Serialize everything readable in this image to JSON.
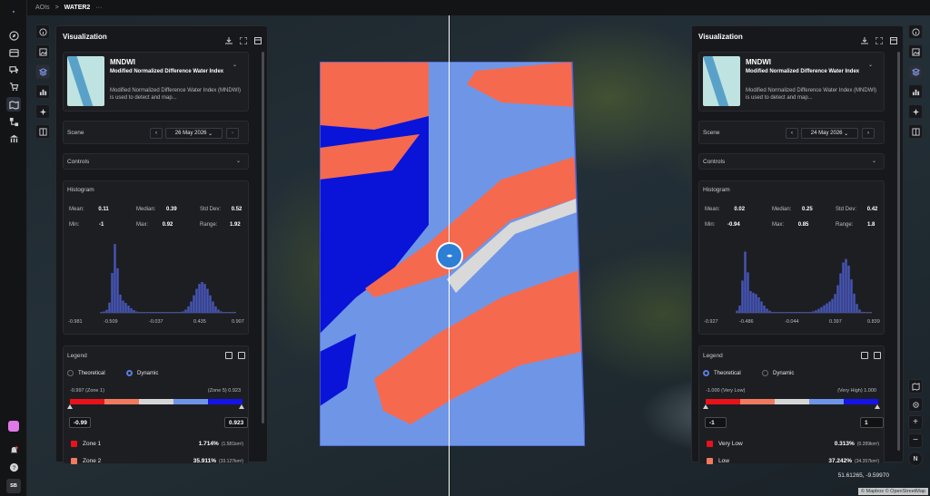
{
  "breadcrumb": {
    "root": "AOIs",
    "sep": ">",
    "current": "WATER2",
    "more": "···"
  },
  "nav": [
    "explore-icon",
    "orders-icon",
    "truck-icon",
    "cart-icon",
    "chart-icon",
    "map-icon",
    "network-icon",
    "wand-icon",
    "library-icon"
  ],
  "user_initials": "SB",
  "panels": {
    "left": {
      "title": "Visualization",
      "index": {
        "name": "MNDWI",
        "full": "Modified Normalized Difference Water Index",
        "desc": "Modified Normalized Difference Water Index (MNDWI) is used to detect and map..."
      },
      "scene_label": "Scene",
      "date": "26 May 2026",
      "controls_label": "Controls",
      "histogram_label": "Histogram",
      "stats": {
        "mean_label": "Mean:",
        "mean": "0.11",
        "median_label": "Median:",
        "median": "0.39",
        "std_label": "Std Dev:",
        "std": "0.52",
        "min_label": "Min:",
        "min": "-1",
        "max_label": "Max:",
        "max": "0.92",
        "range_label": "Range:",
        "range": "1.92"
      },
      "hist_ticks": [
        "-0.981",
        "-0.509",
        "-0.037",
        "0.435",
        "0.907"
      ],
      "legend_label": "Legend",
      "mode_a": "Theoretical",
      "mode_b": "Dynamic",
      "active_mode": "Dynamic",
      "lg_left": "-0.997 (Zone 1)",
      "lg_right": "(Zone 5) 0.923",
      "min_value": "-0.99",
      "max_value": "0.923",
      "zones": [
        {
          "name": "Zone 1",
          "pct": "1.714%",
          "area": "(1.581km²)",
          "color": "#e8121a"
        },
        {
          "name": "Zone 2",
          "pct": "35.911%",
          "area": "(33.127km²)",
          "color": "#f07a5d"
        }
      ]
    },
    "right": {
      "title": "Visualization",
      "index": {
        "name": "MNDWI",
        "full": "Modified Normalized Difference Water Index",
        "desc": "Modified Normalized Difference Water Index (MNDWI) is used to detect and map..."
      },
      "scene_label": "Scene",
      "date": "24 May 2026",
      "controls_label": "Controls",
      "histogram_label": "Histogram",
      "stats": {
        "mean_label": "Mean:",
        "mean": "0.02",
        "median_label": "Median:",
        "median": "0.25",
        "std_label": "Std Dev:",
        "std": "0.42",
        "min_label": "Min:",
        "min": "-0.94",
        "max_label": "Max:",
        "max": "0.85",
        "range_label": "Range:",
        "range": "1.8"
      },
      "hist_ticks": [
        "-0.927",
        "-0.486",
        "-0.044",
        "0.397",
        "0.839"
      ],
      "legend_label": "Legend",
      "mode_a": "Theoretical",
      "mode_b": "Dynamic",
      "active_mode": "Theoretical",
      "lg_left": "-1.000 (Very Low)",
      "lg_right": "(Very High) 1.000",
      "min_value": "-1",
      "max_value": "1",
      "zones": [
        {
          "name": "Very Low",
          "pct": "0.313%",
          "area": "(0.289km²)",
          "color": "#e8121a"
        },
        {
          "name": "Low",
          "pct": "37.242%",
          "area": "(34.357km²)",
          "color": "#f07a5d"
        }
      ]
    }
  },
  "legend_colors": [
    "#e8121a",
    "#f07a5d",
    "#d6d6d6",
    "#6e95e8",
    "#1414e6"
  ],
  "map": {
    "coords": "51.61265, -9.59970",
    "attribution": "© Mapbox © OpenStreetMap",
    "compass": "N"
  },
  "colors": {
    "water_dark": "#0a14d8",
    "water_light": "#6f96e6",
    "land": "#f5694f",
    "neutral": "#d9d9d9",
    "histogram": "#4656b8",
    "accent": "#5b7be0"
  }
}
